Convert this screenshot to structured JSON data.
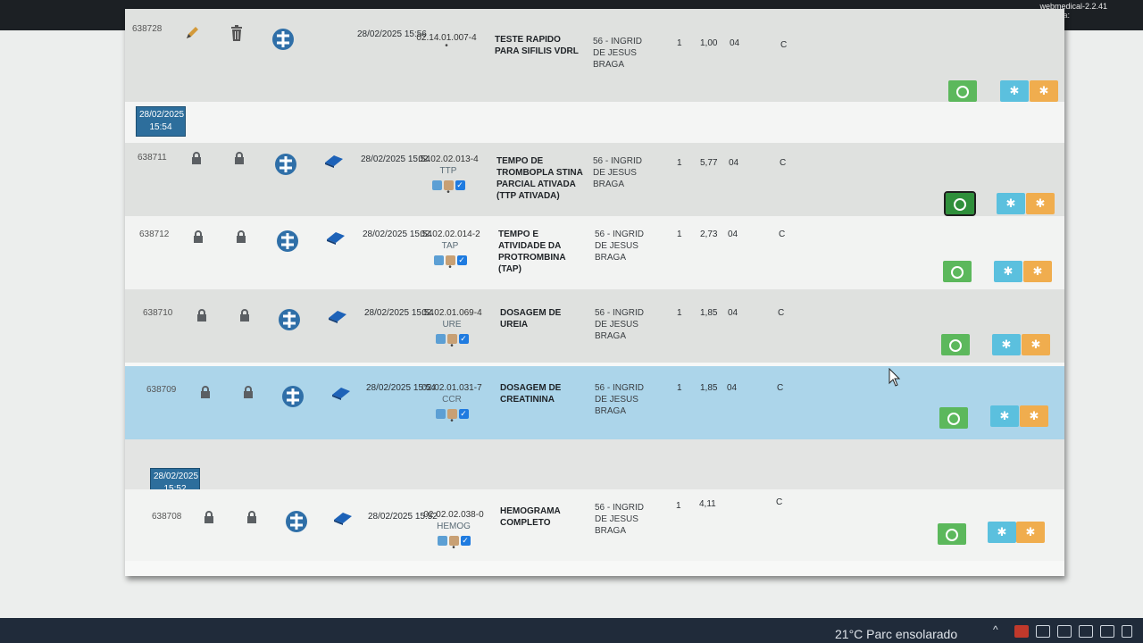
{
  "topbar": {
    "version": "webmedical-2.2.41",
    "license_label": "Licença:"
  },
  "separators": [
    {
      "date": "28/02/2025",
      "time": "15:54"
    },
    {
      "date": "28/02/2025",
      "time": "15:52"
    }
  ],
  "rows": [
    {
      "id": "638728",
      "datetime": "28/02/2025 15:56",
      "code": "02.14.01.007-4",
      "abbr": "",
      "description": "TESTE RAPIDO PARA SIFILIS VDRL",
      "professional": "56 - INGRID DE JESUS BRAGA",
      "qty": "1",
      "value": "1,00",
      "col": "04",
      "status": "C"
    },
    {
      "id": "638711",
      "datetime": "28/02/2025 15:54",
      "code": "02.02.02.013-4",
      "abbr": "TTP",
      "description": "TEMPO DE TROMBOPLA STINA PARCIAL ATIVADA (TTP ATIVADA)",
      "professional": "56 - INGRID DE JESUS BRAGA",
      "qty": "1",
      "value": "5,77",
      "col": "04",
      "status": "C"
    },
    {
      "id": "638712",
      "datetime": "28/02/2025 15:54",
      "code": "02.02.02.014-2",
      "abbr": "TAP",
      "description": "TEMPO E ATIVIDADE DA PROTROMBINA (TAP)",
      "professional": "56 - INGRID DE JESUS BRAGA",
      "qty": "1",
      "value": "2,73",
      "col": "04",
      "status": "C"
    },
    {
      "id": "638710",
      "datetime": "28/02/2025 15:54",
      "code": "02.02.01.069-4",
      "abbr": "URE",
      "description": "DOSAGEM DE UREIA",
      "professional": "56 - INGRID DE JESUS BRAGA",
      "qty": "1",
      "value": "1,85",
      "col": "04",
      "status": "C"
    },
    {
      "id": "638709",
      "datetime": "28/02/2025 15:54",
      "code": "02.02.01.031-7",
      "abbr": "CCR",
      "description": "DOSAGEM DE CREATININA",
      "professional": "56 - INGRID DE JESUS BRAGA",
      "qty": "1",
      "value": "1,85",
      "col": "04",
      "status": "C"
    },
    {
      "id": "638708",
      "datetime": "28/02/2025 15:52",
      "code": "02.02.02.038-0",
      "abbr": "HEMOG",
      "description": "HEMOGRAMA COMPLETO",
      "professional": "56 - INGRID DE JESUS BRAGA",
      "qty": "1",
      "value": "4,11",
      "col": "",
      "status": "C"
    }
  ],
  "colors": {
    "badge": "#2d6e9c",
    "green": "#5cb85c",
    "blue": "#5bc0de",
    "orange": "#f0ad4e",
    "selected": "#acd5ea"
  },
  "icons": {
    "edit": "pencil-icon",
    "delete": "trash-icon",
    "lock": "lock-icon",
    "sus": "sus-logo-icon",
    "eraser": "eraser-icon",
    "action_green": "circle-icon",
    "action_blue": "gear-icon",
    "action_orange": "gear-icon"
  },
  "taskbar": {
    "weather": "21°C  Parc ensolarado"
  }
}
